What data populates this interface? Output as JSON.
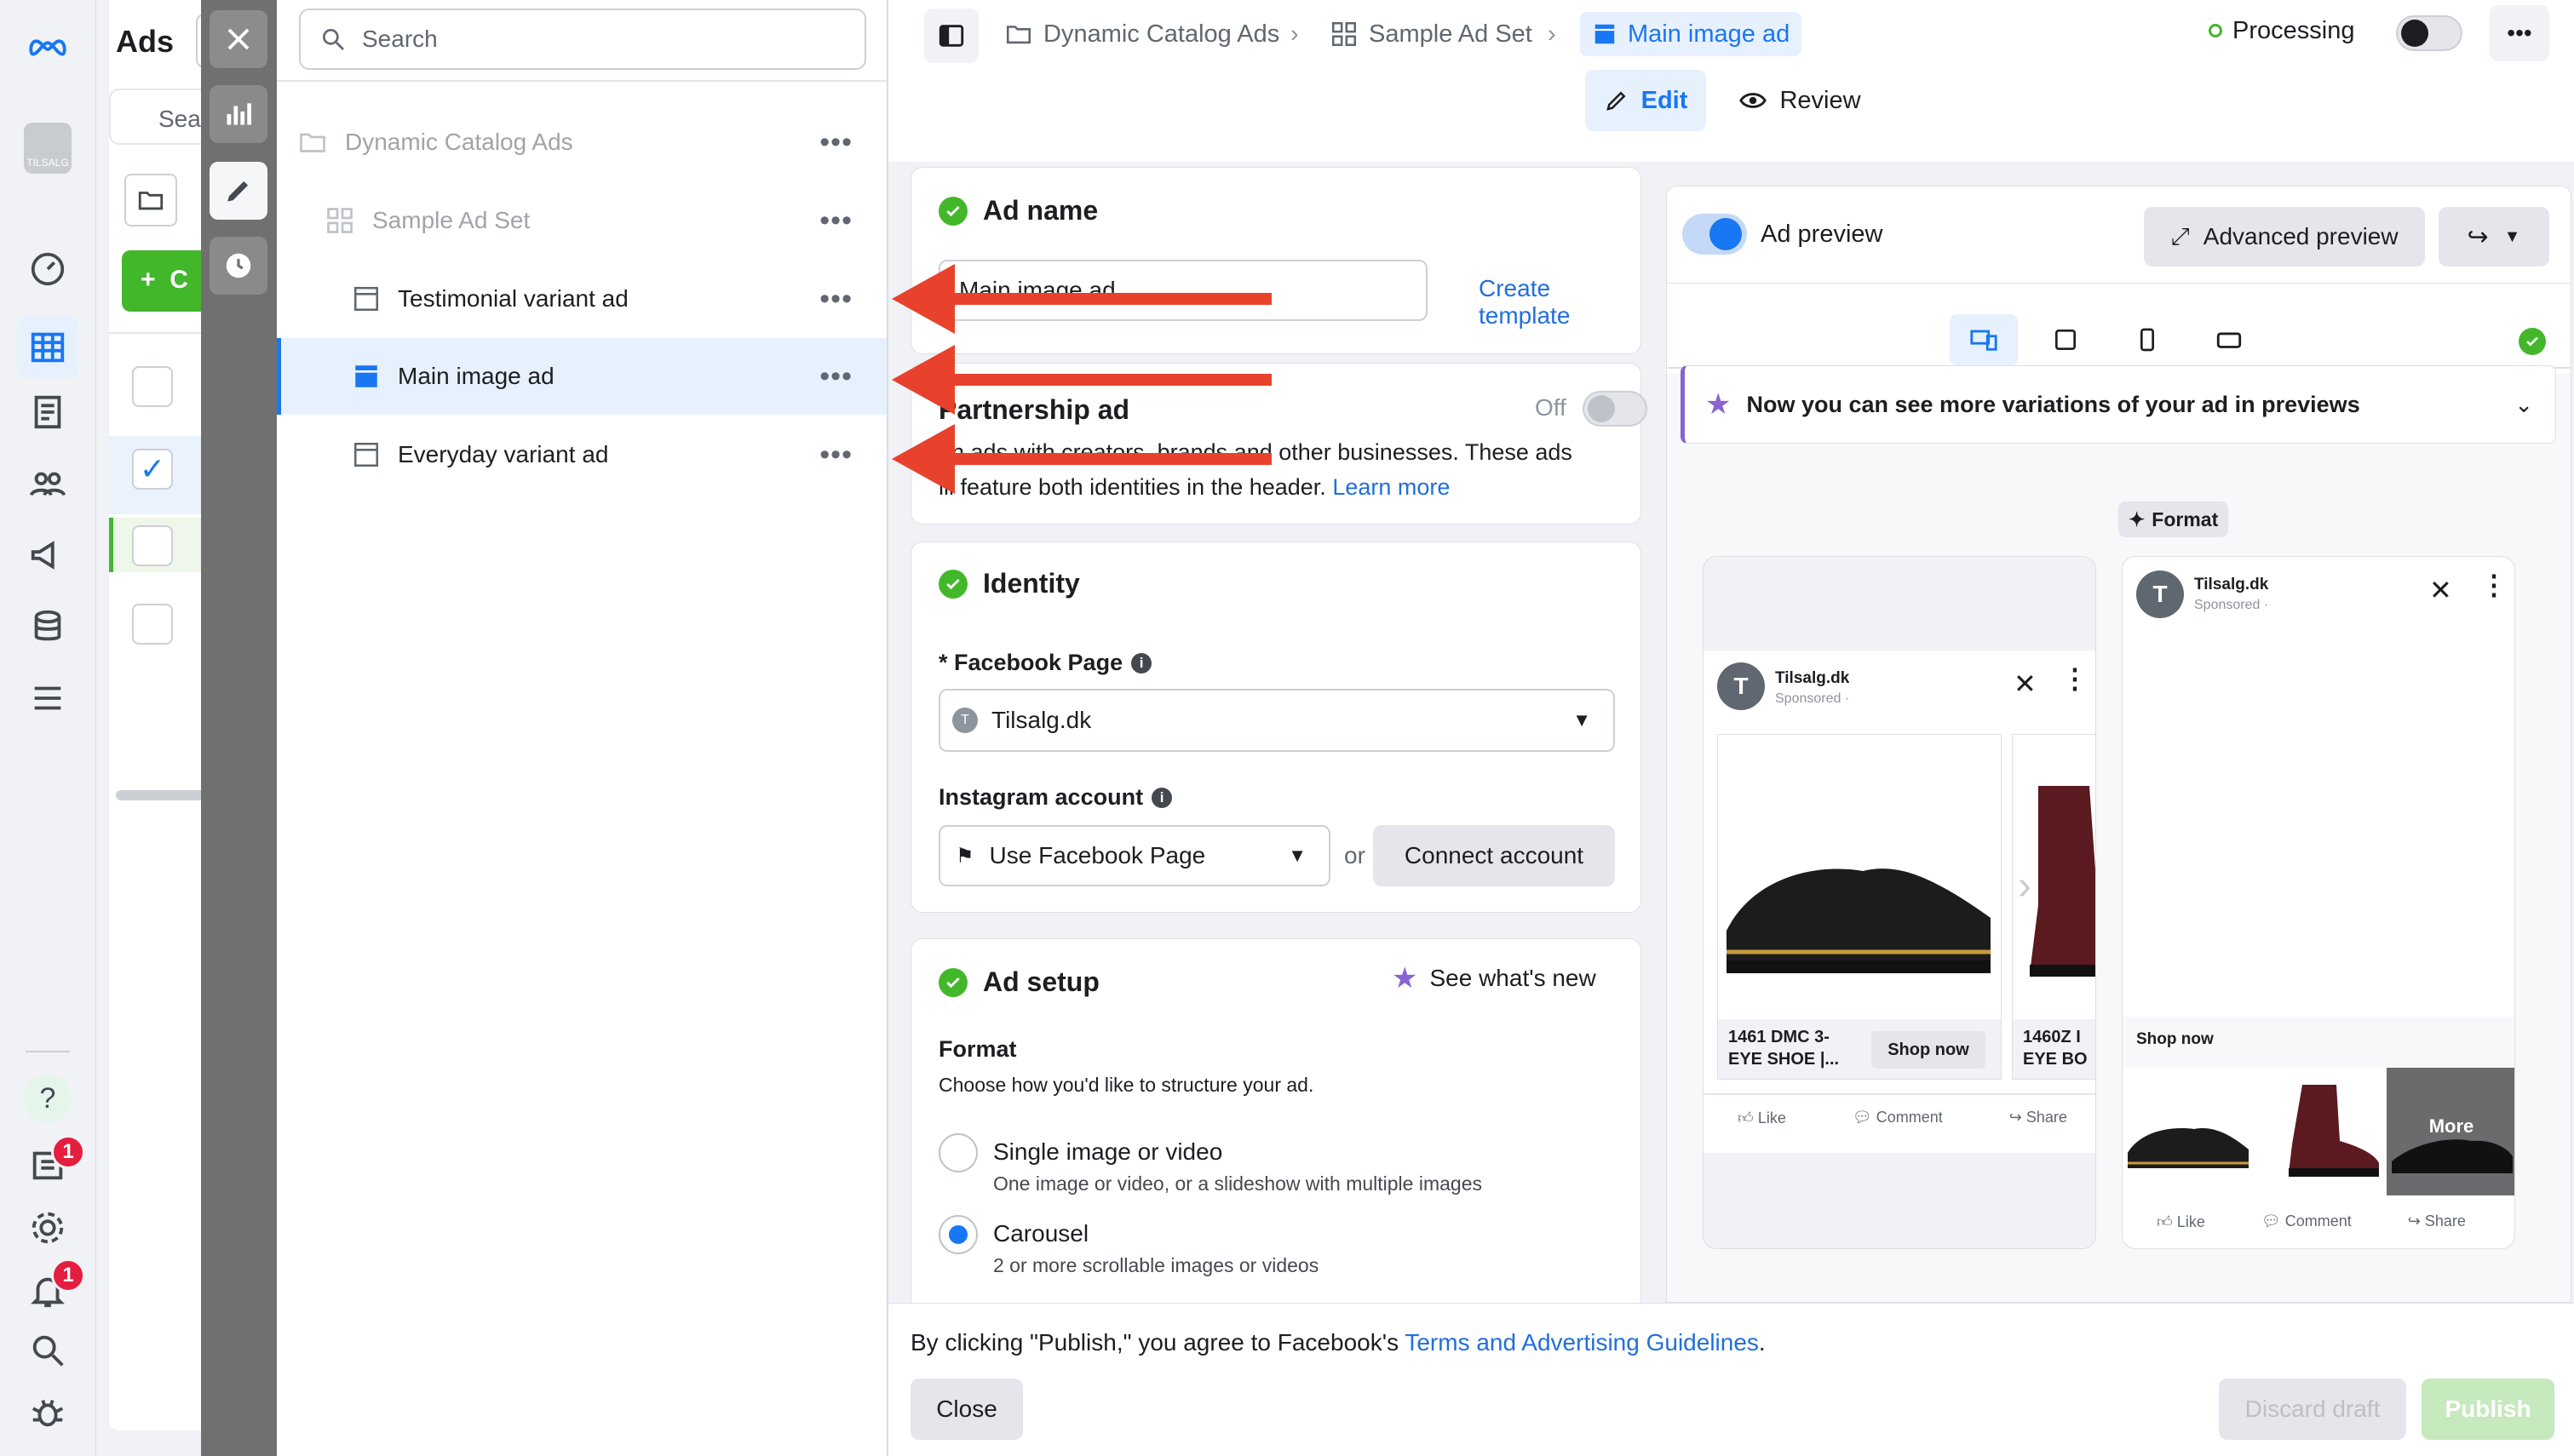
{
  "rail": {
    "logo": "meta-logo",
    "account_label": "TILSALG",
    "help_badge": "1",
    "notif_badge": "1"
  },
  "bg": {
    "title": "Ads",
    "search_placeholder": "Sea",
    "create": "C"
  },
  "tree": {
    "search_placeholder": "Search",
    "items": [
      {
        "label": "Dynamic Catalog Ads"
      },
      {
        "label": "Sample Ad Set"
      },
      {
        "label": "Testimonial variant ad"
      },
      {
        "label": "Main image ad"
      },
      {
        "label": "Everyday variant ad"
      }
    ],
    "more": "•••"
  },
  "header": {
    "crumbs": [
      "Dynamic Catalog Ads",
      "Sample Ad Set",
      "Main image ad"
    ],
    "status": "Processing",
    "more": "•••",
    "tabs": {
      "edit": "Edit",
      "review": "Review"
    }
  },
  "adname": {
    "title": "Ad name",
    "value": "Main image ad",
    "template": "Create template"
  },
  "partnership": {
    "title": "Partnership ad",
    "toggle": "Off",
    "desc_1": "un ads with creators, brands and other businesses. These ads",
    "desc_2": "ill feature both identities in the header.",
    "learn": "Learn more"
  },
  "identity": {
    "title": "Identity",
    "fb_label": "* Facebook Page",
    "fb_value": "Tilsalg.dk",
    "fb_initial": "T",
    "ig_label": "Instagram account",
    "ig_value": "Use Facebook Page",
    "or": "or",
    "connect": "Connect account"
  },
  "adsetup": {
    "title": "Ad setup",
    "whatsnew": "See what's new",
    "format_label": "Format",
    "format_sub": "Choose how you'd like to structure your ad.",
    "options": [
      {
        "title": "Single image or video",
        "sub": "One image or video, or a slideshow with multiple images"
      },
      {
        "title": "Carousel",
        "sub": "2 or more scrollable images or videos"
      }
    ]
  },
  "preview": {
    "toggle_label": "Ad preview",
    "advanced": "Advanced preview",
    "banner": "Now you can see more variations of your ad in previews",
    "format_chip": "Format",
    "page": "Tilsalg.dk",
    "initial": "T",
    "sponsored": "Sponsored ·",
    "card1_title_1": "1461 DMC 3-",
    "card1_title_2": "EYE SHOE |...",
    "card2_title_1": "1460Z I",
    "card2_title_2": "EYE BO",
    "shop": "Shop now",
    "like": "Like",
    "comment": "Comment",
    "share": "Share",
    "more": "More"
  },
  "footer": {
    "legal_prefix": "By clicking \"Publish,\" you agree to Facebook's",
    "legal_link": "Terms and Advertising Guidelines",
    "legal_end": ".",
    "close": "Close",
    "discard": "Discard draft",
    "publish": "Publish"
  },
  "colors": {
    "accent": "#1877f2",
    "success": "#42b72a",
    "arrow": "#e8412c",
    "status_dot": "#42b72a"
  }
}
